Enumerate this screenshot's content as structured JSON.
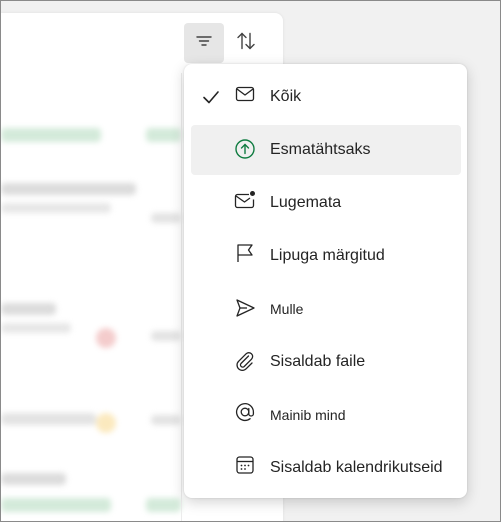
{
  "toolbar": {
    "filter_icon": "filter-icon",
    "sort_icon": "sort-icon"
  },
  "filter_menu": {
    "items": [
      {
        "label": "Kõik",
        "icon": "mail-icon",
        "checked": true
      },
      {
        "label": "Esmatähtsaks",
        "icon": "arrow-up-circle-icon",
        "checked": false
      },
      {
        "label": "Lugemata",
        "icon": "mail-unread-icon",
        "checked": false
      },
      {
        "label": "Lipuga märgitud",
        "icon": "flag-icon",
        "checked": false
      },
      {
        "label": "Mulle",
        "icon": "send-icon",
        "checked": false
      },
      {
        "label": "Sisaldab faile",
        "icon": "attach-icon",
        "checked": false
      },
      {
        "label": "Mainib mind",
        "icon": "mention-icon",
        "checked": false
      },
      {
        "label": "Sisaldab kalendrikutseid",
        "icon": "calendar-icon",
        "checked": false
      }
    ]
  },
  "colors": {
    "accent_green": "#107c41",
    "menu_bg": "#ffffff",
    "hover_bg": "#f0f0f0",
    "text": "#242424"
  }
}
